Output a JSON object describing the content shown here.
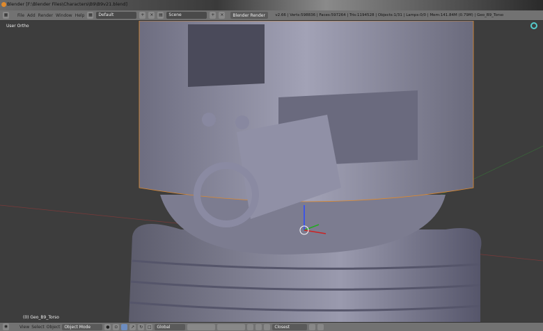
{
  "window": {
    "title": "Blender [F:\\Blender Files\\Characters\\B9\\B9v21.blend]"
  },
  "top_header": {
    "menus": [
      "File",
      "Add",
      "Render",
      "Window",
      "Help"
    ],
    "layout": "Default",
    "scene": "Scene",
    "render_engine": "Blender Render",
    "stats": "v2.66 | Verts:598836 | Faces:597264 | Tris:1194528 | Objects:1/31 | Lamps:0/0 | Mem:141.84M (0.79M) | Geo_B9_Torso"
  },
  "viewport": {
    "view_label": "User Ortho",
    "object_label": "(0) Geo_B9_Torso"
  },
  "bottom_header": {
    "menus": [
      "View",
      "Select",
      "Object"
    ],
    "mode": "Object Mode",
    "orientation": "Global",
    "snap_target": "Closest"
  },
  "colors": {
    "background": "#3d3d3d",
    "header": "#727272",
    "model": "#8a8aa0",
    "selection": "#e08a2c"
  }
}
